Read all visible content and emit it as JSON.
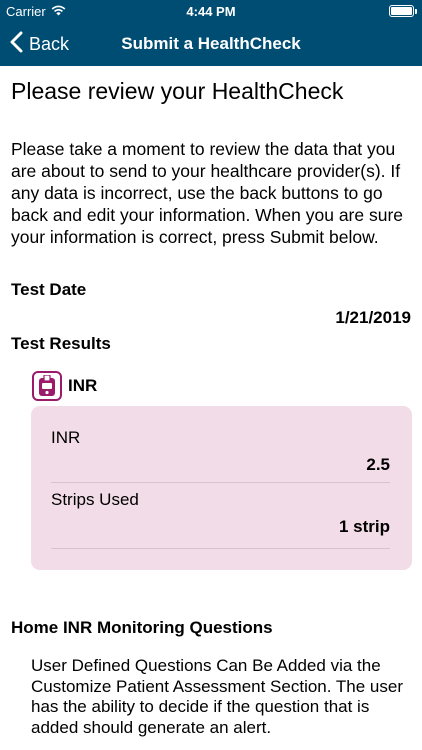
{
  "status_bar": {
    "carrier": "Carrier",
    "time": "4:44 PM"
  },
  "nav": {
    "back_label": "Back",
    "title": "Submit a HealthCheck"
  },
  "page": {
    "title": "Please review your HealthCheck",
    "intro": "Please take a moment to review the data that you are about to send to your healthcare provider(s). If any data is incorrect, use the back buttons to go back and edit your information. When you are sure your information is correct, press Submit below."
  },
  "test_date": {
    "label": "Test Date",
    "value": "1/21/2019"
  },
  "test_results": {
    "label": "Test Results",
    "section_title": "INR",
    "rows": [
      {
        "label": "INR",
        "value": "2.5"
      },
      {
        "label": "Strips Used",
        "value": "1 strip"
      }
    ]
  },
  "questions": {
    "title": "Home INR Monitoring Questions",
    "text": "User Defined Questions Can Be Added via the Customize Patient Assessment Section. The user has the ability to decide if the question that is added should generate an alert."
  },
  "colors": {
    "nav_background": "#004d73",
    "accent_magenta": "#9b1b6b",
    "card_background": "#f2dce7"
  }
}
